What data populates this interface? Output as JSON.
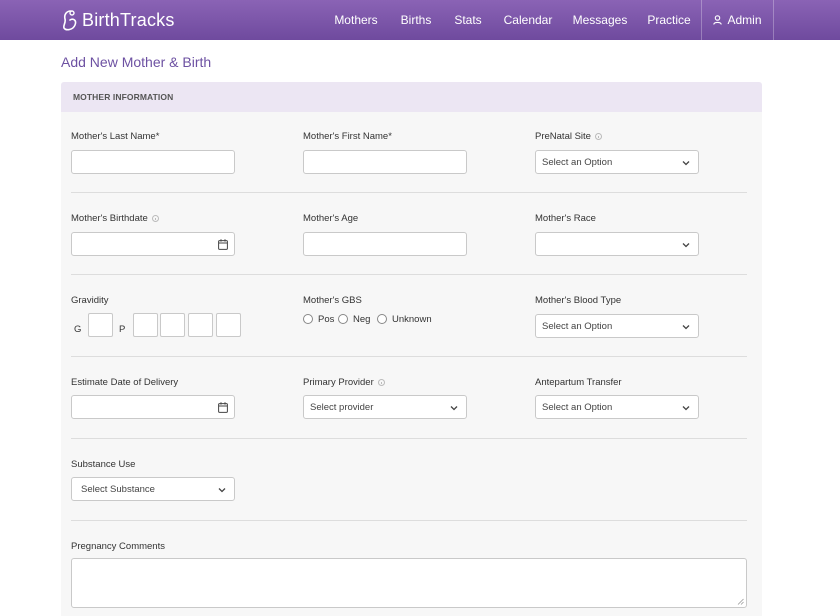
{
  "brand": {
    "name": "BirthTracks"
  },
  "nav": {
    "items": [
      "Mothers",
      "Births",
      "Stats",
      "Calendar",
      "Messages",
      "Practice"
    ],
    "admin": "Admin"
  },
  "page": {
    "title": "Add New Mother & Birth"
  },
  "section": {
    "title": "MOTHER INFORMATION"
  },
  "fields": {
    "last_name": {
      "label": "Mother's Last Name*",
      "value": ""
    },
    "first_name": {
      "label": "Mother's First Name*",
      "value": ""
    },
    "prenatal_site": {
      "label": "PreNatal Site",
      "value": "Select an Option"
    },
    "birthdate": {
      "label": "Mother's Birthdate",
      "value": ""
    },
    "age": {
      "label": "Mother's Age",
      "value": ""
    },
    "race": {
      "label": "Mother's Race",
      "value": ""
    },
    "gravidity": {
      "label": "Gravidity",
      "g": "G",
      "p": "P"
    },
    "gbs": {
      "label": "Mother's GBS",
      "options": [
        "Pos",
        "Neg",
        "Unknown"
      ]
    },
    "blood_type": {
      "label": "Mother's Blood Type",
      "value": "Select an Option"
    },
    "edd": {
      "label": "Estimate Date of Delivery",
      "value": ""
    },
    "primary_provider": {
      "label": "Primary Provider",
      "value": "Select provider"
    },
    "antepartum": {
      "label": "Antepartum Transfer",
      "value": "Select an Option"
    },
    "substance": {
      "label": "Substance Use",
      "value": "Select Substance"
    },
    "comments": {
      "label": "Pregnancy Comments",
      "value": ""
    }
  },
  "colors": {
    "header": "#7a55a8",
    "accent": "#6d51a2",
    "section_bg": "#ece6f3"
  }
}
